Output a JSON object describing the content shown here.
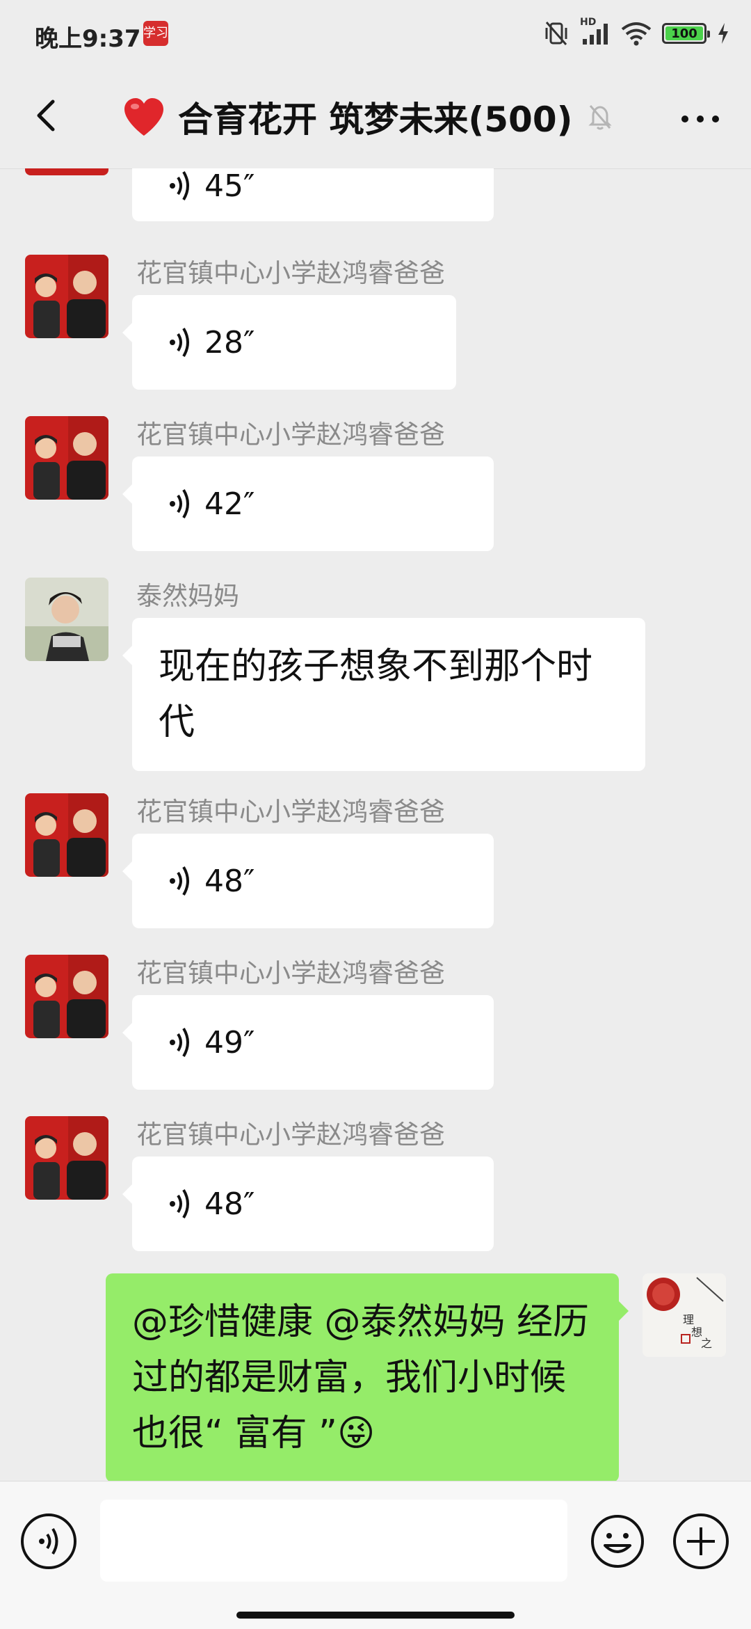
{
  "status_bar": {
    "time": "晚上9:37",
    "app_badge": "学习",
    "network": "HD",
    "battery": "100"
  },
  "header": {
    "emoji": "❤️",
    "title": "合育花开 筑梦未来(500)"
  },
  "messages": [
    {
      "sender": "",
      "duration": "45″"
    },
    {
      "sender": "花官镇中心小学赵鸿睿爸爸",
      "duration": "28″"
    },
    {
      "sender": "花官镇中心小学赵鸿睿爸爸",
      "duration": "42″"
    },
    {
      "sender": "泰然妈妈",
      "text": "现在的孩子想象不到那个时代"
    },
    {
      "sender": "花官镇中心小学赵鸿睿爸爸",
      "duration": "48″"
    },
    {
      "sender": "花官镇中心小学赵鸿睿爸爸",
      "duration": "49″"
    },
    {
      "sender": "花官镇中心小学赵鸿睿爸爸",
      "duration": "48″"
    },
    {
      "text": "@珍惜健康 @泰然妈妈  经历过的都是财富，我们小时候也很“ 富有 ”😜"
    }
  ],
  "input": {
    "placeholder": ""
  },
  "colors": {
    "background": "#ededed",
    "bubble_other": "#ffffff",
    "bubble_mine": "#95ec69",
    "sender_name": "#8a8a8a"
  },
  "icons": [
    "back-arrow-icon",
    "heart-emoji-icon",
    "mute-bell-icon",
    "more-icon",
    "voice-wave-icon",
    "voice-mode-icon",
    "emoji-icon",
    "plus-icon"
  ]
}
